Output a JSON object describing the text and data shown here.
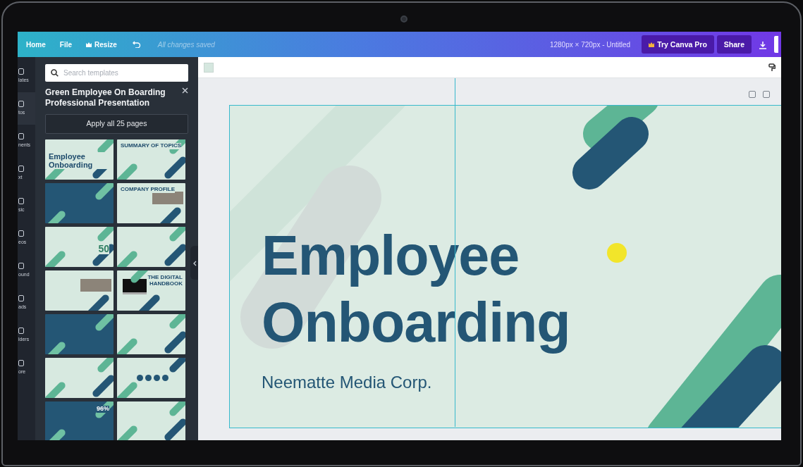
{
  "topbar": {
    "menu": [
      {
        "kind": "text",
        "label": "Home"
      },
      {
        "kind": "text",
        "label": "File"
      },
      {
        "kind": "crown",
        "label": "Resize"
      }
    ],
    "save_status": "All changes saved",
    "document": "1280px × 720px - Untitled",
    "try_pro": "Try Canva Pro",
    "share": "Share"
  },
  "rail": [
    {
      "label": "lates",
      "selected": false
    },
    {
      "label": "tos",
      "selected": true
    },
    {
      "label": "nents",
      "selected": false
    },
    {
      "label": "xt",
      "selected": false
    },
    {
      "label": "sic",
      "selected": false
    },
    {
      "label": "eos",
      "selected": false
    },
    {
      "label": "ound",
      "selected": false
    },
    {
      "label": "ads",
      "selected": false
    },
    {
      "label": "lders",
      "selected": false
    },
    {
      "label": "ore",
      "selected": false
    }
  ],
  "panel": {
    "search": {
      "placeholder": "Search templates"
    },
    "title": "Green Employee On Boarding Professional Presentation",
    "apply": "Apply all 25 pages",
    "thumbnails": [
      {
        "kind": "light",
        "heading": "Employee Onboarding"
      },
      {
        "kind": "light",
        "heading": "SUMMARY OF TOPICS"
      },
      {
        "kind": "dark"
      },
      {
        "kind": "photo",
        "heading": "COMPANY PROFILE"
      },
      {
        "kind": "light",
        "heading": "50"
      },
      {
        "kind": "light"
      },
      {
        "kind": "photo"
      },
      {
        "kind": "laptop",
        "heading": "THE DIGITAL HANDBOOK"
      },
      {
        "kind": "dark"
      },
      {
        "kind": "light"
      },
      {
        "kind": "light"
      },
      {
        "kind": "circles"
      },
      {
        "kind": "dark",
        "heading": "96%"
      },
      {
        "kind": "light"
      }
    ]
  },
  "slide": {
    "title_lines": [
      "Employee",
      "Onboarding"
    ],
    "subtitle": "Neematte Media Corp."
  }
}
